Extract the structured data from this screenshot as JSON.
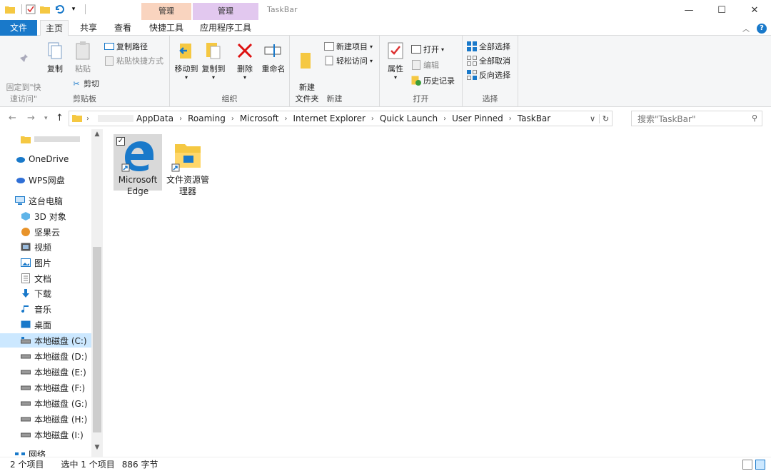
{
  "window": {
    "title": "TaskBar"
  },
  "ribbon_tabs": {
    "file": "文件",
    "home": "主页",
    "share": "共享",
    "view": "查看",
    "context_group_1": "管理",
    "context_group_2": "管理",
    "shortcut_tools": "快捷工具",
    "app_tools": "应用程序工具"
  },
  "clipboard": {
    "pin": "固定到\"快\n速访问\"",
    "copy": "复制",
    "paste": "粘贴",
    "copy_path": "复制路径",
    "paste_shortcut": "粘贴快捷方式",
    "cut": "剪切",
    "label": "剪贴板"
  },
  "organize": {
    "move_to": "移动到",
    "copy_to": "复制到",
    "delete": "删除",
    "rename": "重命名",
    "label": "组织"
  },
  "new": {
    "new_folder": "新建\n文件夹",
    "new_item": "新建项目",
    "easy_access": "轻松访问",
    "label": "新建"
  },
  "open": {
    "properties": "属性",
    "open": "打开",
    "edit": "编辑",
    "history": "历史记录",
    "label": "打开"
  },
  "select": {
    "select_all": "全部选择",
    "select_none": "全部取消",
    "invert": "反向选择",
    "label": "选择"
  },
  "address": {
    "crumbs": [
      "AppData",
      "Roaming",
      "Microsoft",
      "Internet Explorer",
      "Quick Launch",
      "User Pinned",
      "TaskBar"
    ]
  },
  "search": {
    "placeholder": "搜索\"TaskBar\""
  },
  "navpane": {
    "items": [
      "OneDrive",
      "WPS网盘",
      "这台电脑",
      "3D 对象",
      "坚果云",
      "视频",
      "图片",
      "文档",
      "下载",
      "音乐",
      "桌面",
      "本地磁盘 (C:)",
      "本地磁盘 (D:)",
      "本地磁盘 (E:)",
      "本地磁盘 (F:)",
      "本地磁盘 (G:)",
      "本地磁盘 (H:)",
      "本地磁盘 (I:)",
      "网络"
    ]
  },
  "files": [
    {
      "name": "Microsoft Edge",
      "selected": true
    },
    {
      "name": "文件资源管理器",
      "selected": false
    }
  ],
  "status": {
    "count": "2 个项目",
    "selected": "选中 1 个项目",
    "size": "886 字节"
  },
  "colors": {
    "accent": "#1979ca",
    "selection": "#cce8ff"
  }
}
